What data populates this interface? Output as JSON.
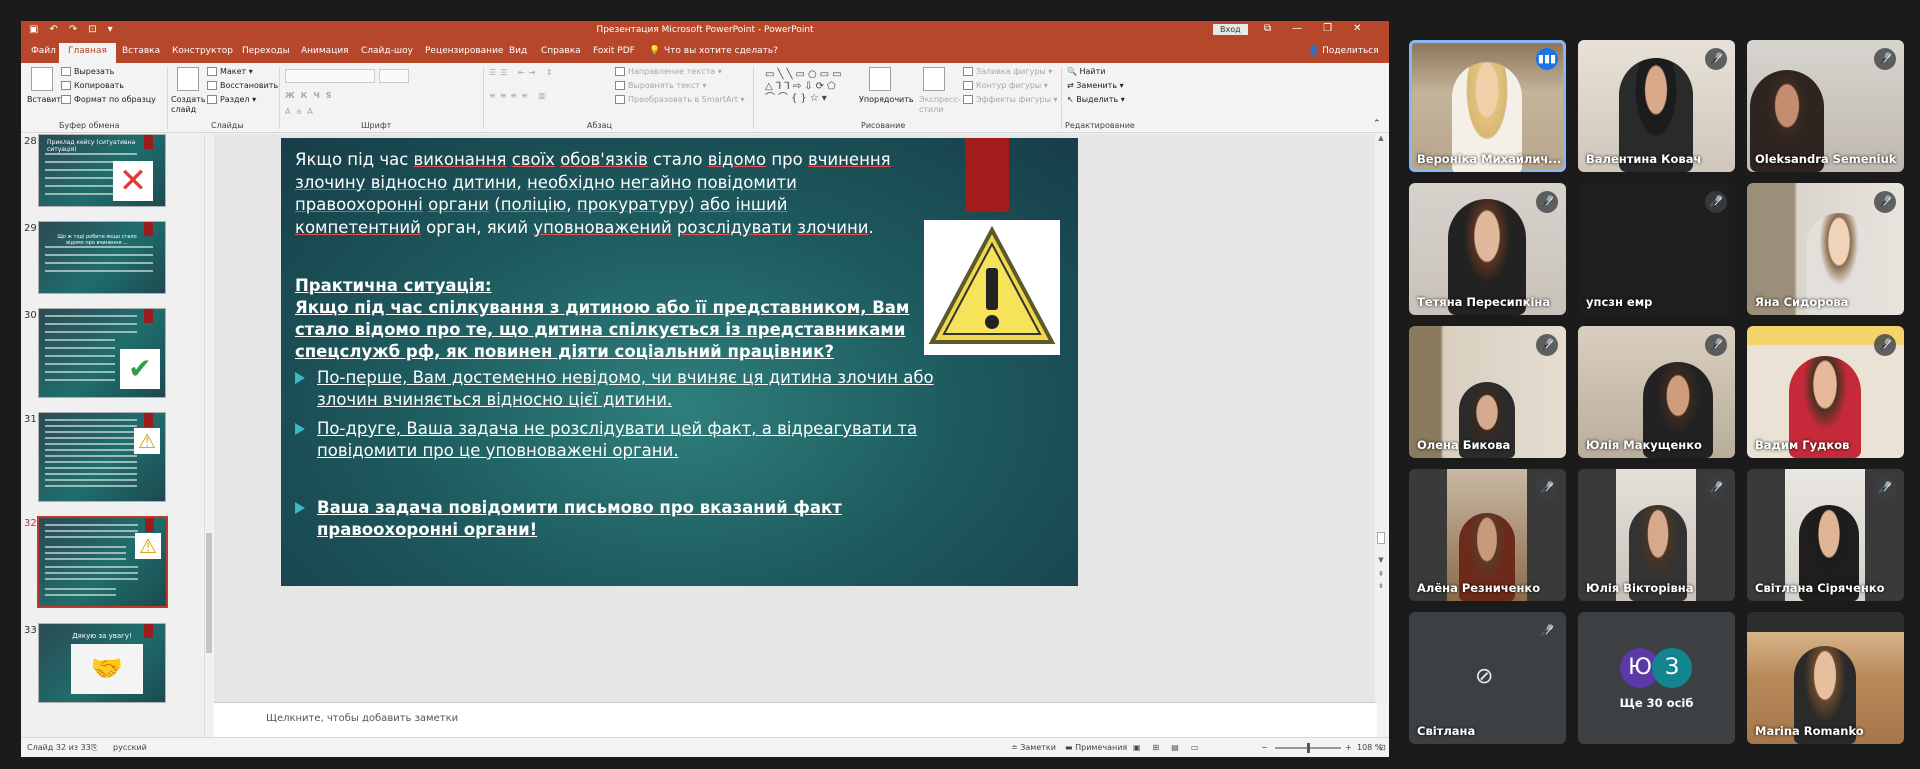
{
  "window": {
    "title": "Презентация Microsoft PowerPoint - PowerPoint",
    "login": "Вход"
  },
  "menu": {
    "tabs": [
      "Файл",
      "Главная",
      "Вставка",
      "Конструктор",
      "Переходы",
      "Анимация",
      "Слайд-шоу",
      "Рецензирование",
      "Вид",
      "Справка",
      "Foxit PDF",
      "Что вы хотите сделать?"
    ],
    "share": "Поделиться"
  },
  "ribbon": {
    "paste": "Вставить",
    "cut": "Вырезать",
    "copy": "Копировать",
    "format_painter": "Формат по образцу",
    "clipboard_group": "Буфер обмена",
    "new_slide": "Создать слайд",
    "layout": "Макет",
    "reset": "Восстановить",
    "section": "Раздел",
    "slides_group": "Слайды",
    "font_group": "Шрифт",
    "text_direction": "Направление текста",
    "align_text": "Выровнять текст",
    "smartart": "Преобразовать в SmartArt",
    "paragraph_group": "Абзац",
    "arrange": "Упорядочить",
    "quick_styles": "Экспресс-стили",
    "shape_fill": "Заливка фигуры",
    "shape_outline": "Контур фигуры",
    "shape_effects": "Эффекты фигуры",
    "drawing_group": "Рисование",
    "find": "Найти",
    "replace": "Заменить",
    "select": "Выделить",
    "editing_group": "Редактирование"
  },
  "thumbnails": [
    {
      "num": "28",
      "title": "Приклад кейсу (ситуативна ситуація)"
    },
    {
      "num": "29",
      "title": "Що ж тоді робити якщо стало відомо про вчинення ..."
    },
    {
      "num": "30",
      "title": ""
    },
    {
      "num": "31",
      "title": ""
    },
    {
      "num": "32",
      "title": ""
    },
    {
      "num": "33",
      "title": "Дякую за увагу!"
    }
  ],
  "slide": {
    "para1_parts": [
      "Якщо під час ",
      "виконання",
      " ",
      "своїх",
      " ",
      "обов'язків",
      " стало ",
      "відомо",
      " про ",
      "вчинення",
      " ",
      "злочину",
      " ",
      "відносно",
      " ",
      "дитини",
      ", ",
      "необхідно",
      " ",
      "негайно",
      " ",
      "повідомити",
      " ",
      "правоохоронні",
      " ",
      "органи",
      " (",
      "поліцію",
      ", ",
      "прокуратуру",
      ") ",
      "або",
      " ",
      "інший",
      " ",
      "компетентний",
      " орган, який ",
      "уповноважений",
      " ",
      "розслідувати",
      " ",
      "злочини",
      "."
    ],
    "practical_title": "Практична ситуація:",
    "practical_question": "Якщо під час спілкування з дитиною або її представником, Вам стало відомо про те, що дитина спілкується із представниками спецслужб рф, як повинен діяти соціальний працівник?",
    "bullets": [
      "По-перше, Вам достеменно невідомо, чи вчиняє ця дитина злочин або злочин вчиняється відносно цієї дитини.",
      "По-друге, Ваша задача не розслідувати цей факт, а відреагувати та повідомити про це уповноважені органи."
    ],
    "final_bullet": "Ваша задача повідомити письмово про вказаний факт правоохоронні органи!"
  },
  "notes_placeholder": "Щелкните, чтобы добавить заметки",
  "status": {
    "slide_info": "Слайд 32 из 33",
    "language": "русский",
    "notes": "Заметки",
    "comments": "Примечания",
    "zoom": "108 %"
  },
  "participants": [
    {
      "name": "Вероніка Михайлич...",
      "speaking": true
    },
    {
      "name": "Валентина Ковач"
    },
    {
      "name": "Oleksandra Semeniuk"
    },
    {
      "name": "Тетяна Пересипкіна"
    },
    {
      "name": "упсзн емр"
    },
    {
      "name": "Яна Сидорова"
    },
    {
      "name": "Олена Бикова"
    },
    {
      "name": "Юлія Макущенко"
    },
    {
      "name": "Вадим Гудков"
    },
    {
      "name": "Алёна Резниченко"
    },
    {
      "name": "Юлія Вікторівна"
    },
    {
      "name": "Світлана Сіряченко"
    },
    {
      "name": "Світлана"
    },
    {
      "name": "Ще 30 осіб",
      "avatars": [
        "Ю",
        "З"
      ]
    },
    {
      "name": "Marina Romanko"
    }
  ],
  "colors": {
    "accent": "#b7472a",
    "slide_bg": "#1d5a5e",
    "red_bar": "#a31c1c",
    "bullet": "#3cb8c8",
    "meet_bg": "#1b1b1b",
    "tile_bg": "#3c4043"
  }
}
